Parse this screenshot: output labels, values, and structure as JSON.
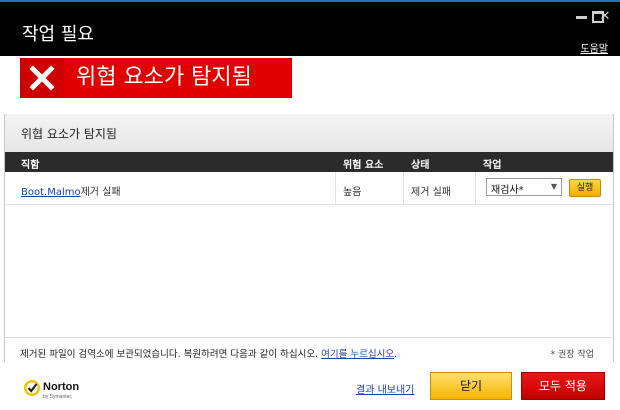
{
  "window": {
    "title": "작업 필요",
    "help_label": "도움말"
  },
  "alert": {
    "banner_text": "위협 요소가 탐지됨"
  },
  "section": {
    "title": "위협 요소가 탐지됨"
  },
  "table": {
    "columns": [
      "직함",
      "위험 요소",
      "상태",
      "작업"
    ],
    "rows": [
      {
        "threat_name": "Boot.Malmo",
        "threat_suffix": "제거 실패",
        "risk": "높음",
        "status": "제거 실패",
        "action_selected": "재검사*",
        "run_label": "실행"
      }
    ]
  },
  "footer": {
    "note_text": "제거된 파일이 검역소에 보관되었습니다. 복원하려면 다음과 같이 하십시오. ",
    "note_link": "여기를 누르십시오",
    "note_end": ".",
    "recommended": "* 권장 작업",
    "export_label": "결과 내보내기",
    "close_label": "닫기",
    "apply_all_label": "모두 적용",
    "logo_text": "Norton",
    "logo_sub": "by Symantec"
  },
  "colors": {
    "alert_red": "#e00000",
    "accent_yellow": "#f5b400",
    "title_bar": "#000000"
  }
}
